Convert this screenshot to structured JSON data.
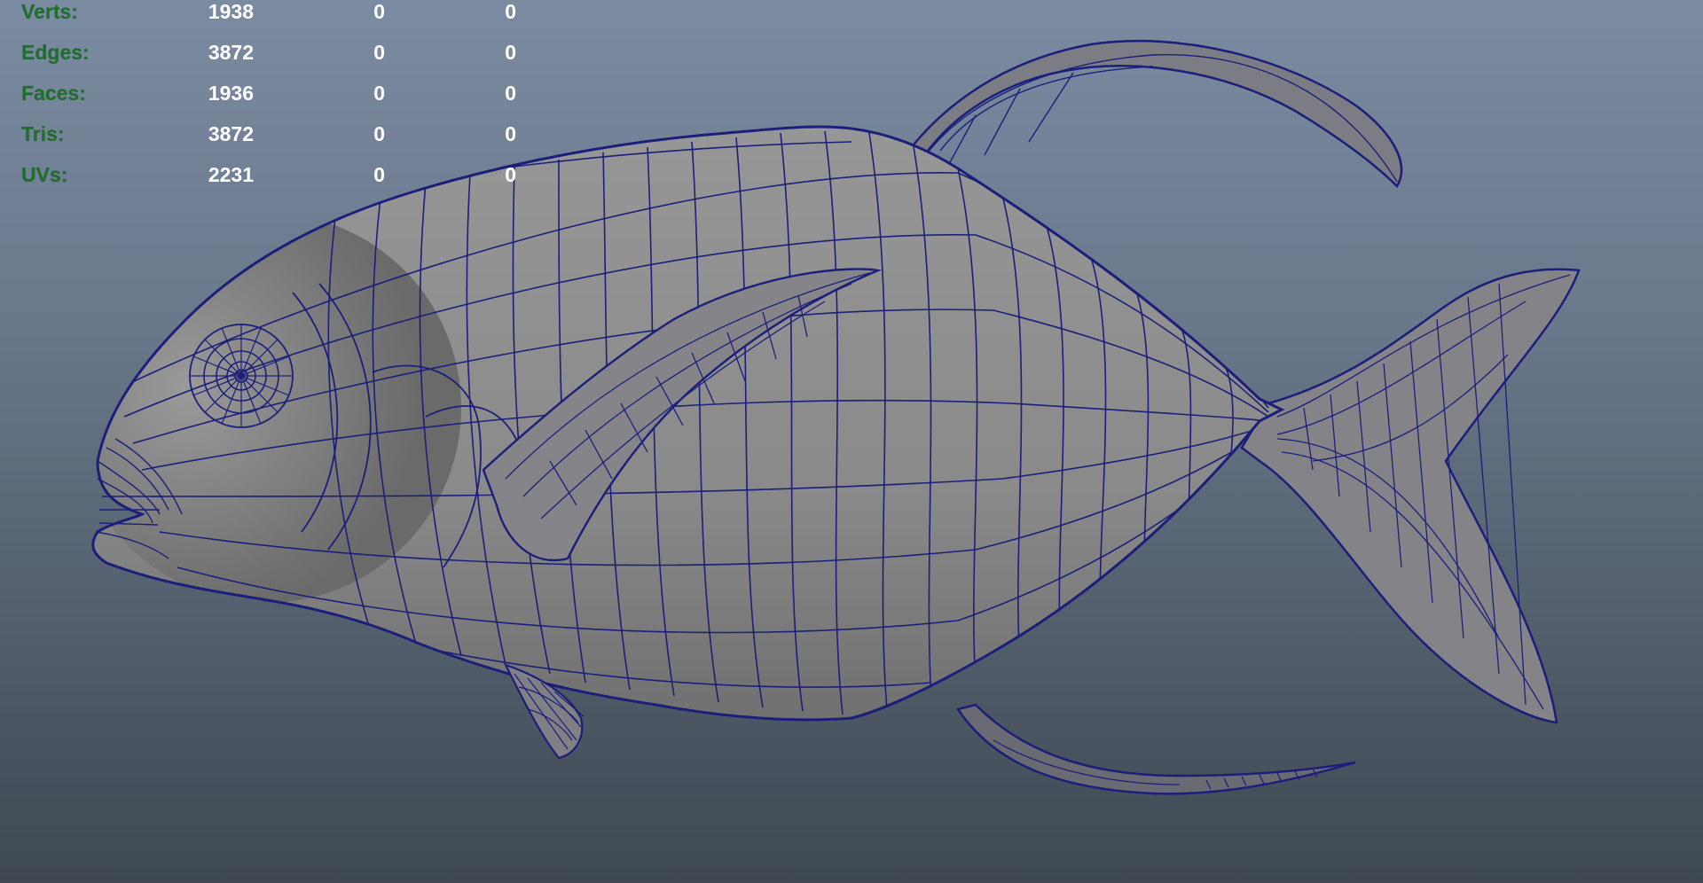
{
  "viewport": {
    "background_top": "#7b8ba1",
    "background_bottom": "#3f4852",
    "wire_color": "#1b1f7a",
    "shade_color": "#8e8e8e"
  },
  "heads_up_display": {
    "label_color": "#1e6f2c",
    "value_color": "#ffffff",
    "rows": [
      {
        "label": "Verts:",
        "values": [
          "1938",
          "0",
          "0"
        ]
      },
      {
        "label": "Edges:",
        "values": [
          "3872",
          "0",
          "0"
        ]
      },
      {
        "label": "Faces:",
        "values": [
          "1936",
          "0",
          "0"
        ]
      },
      {
        "label": "Tris:",
        "values": [
          "3872",
          "0",
          "0"
        ]
      },
      {
        "label": "UVs:",
        "values": [
          "2231",
          "0",
          "0"
        ]
      }
    ]
  },
  "model": {
    "icon": "fish-wireframe-mesh"
  }
}
